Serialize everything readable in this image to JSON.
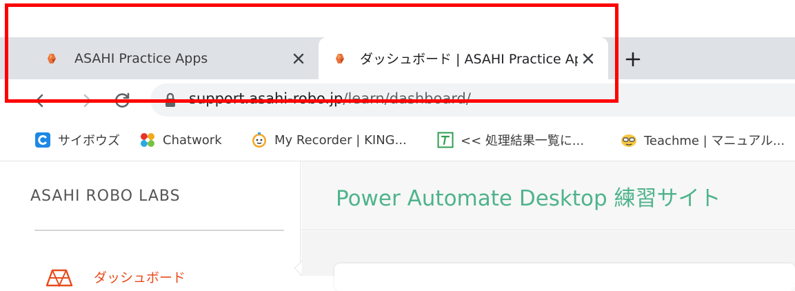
{
  "browser": {
    "tabs": [
      {
        "title": "ASAHI Practice Apps",
        "active": false
      },
      {
        "title": "ダッシュボード | ASAHI Practice Apps",
        "active": true
      }
    ],
    "new_tab_label": "+",
    "address": {
      "host": "support.asahi-robo.jp",
      "path": "/learn/dashboard/"
    },
    "bookmarks": [
      {
        "label": "サイボウズ",
        "icon": "cybozu-icon"
      },
      {
        "label": "Chatwork",
        "icon": "chatwork-icon"
      },
      {
        "label": "My Recorder | KING...",
        "icon": "recorder-icon"
      },
      {
        "label": "<< 処理結果一覧に...",
        "icon": "text-t-icon"
      },
      {
        "label": "Teachme | マニュアル...",
        "icon": "teachme-icon"
      }
    ]
  },
  "sidebar": {
    "brand": "ASAHI ROBO LABS",
    "items": [
      {
        "label": "ダッシュボード",
        "icon": "dashboard-icon"
      }
    ]
  },
  "main": {
    "title": "Power Automate Desktop 練習サイト"
  },
  "colors": {
    "highlight": "#ff0000",
    "accent_green": "#4fb38c",
    "accent_orange": "#e84b1a",
    "tabstrip": "#dee1e6"
  }
}
